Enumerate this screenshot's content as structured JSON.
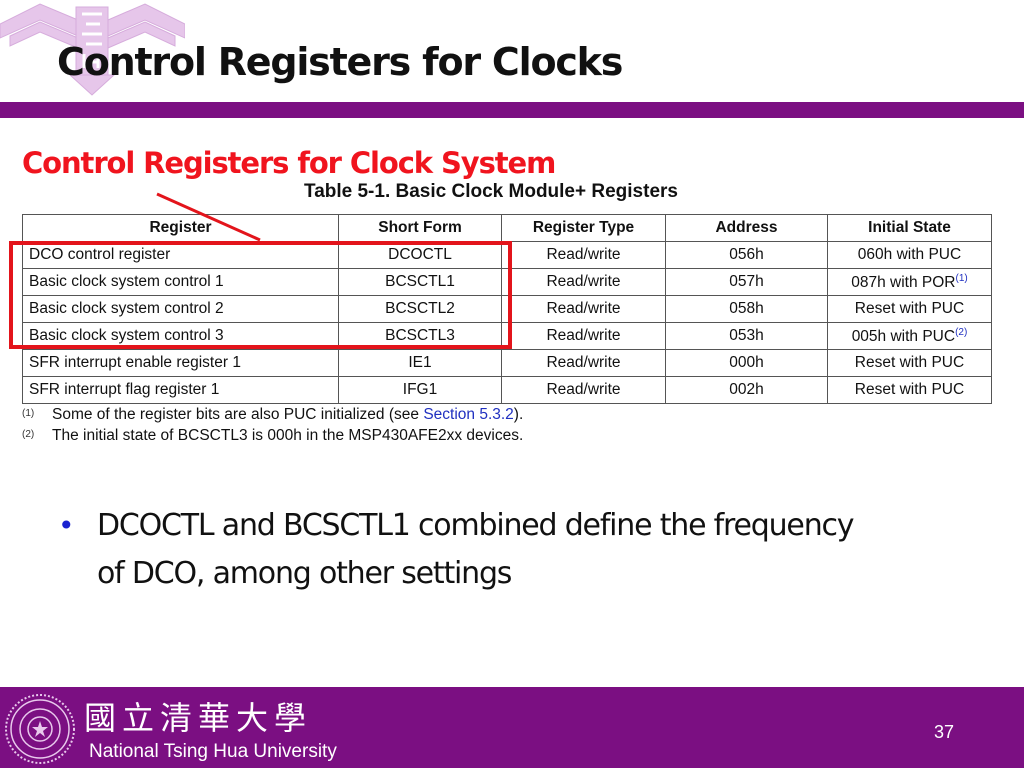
{
  "slide": {
    "title": "Control Registers for Clocks",
    "subtitle": "Control Registers for Clock System",
    "page_number": "37"
  },
  "table": {
    "caption": "Table 5-1. Basic Clock Module+ Registers",
    "headers": [
      "Register",
      "Short Form",
      "Register Type",
      "Address",
      "Initial State"
    ],
    "rows": [
      {
        "register": "DCO control register",
        "short_form": "DCOCTL",
        "type": "Read/write",
        "address": "056h",
        "initial_state": "060h with PUC",
        "note": ""
      },
      {
        "register": "Basic clock system control 1",
        "short_form": "BCSCTL1",
        "type": "Read/write",
        "address": "057h",
        "initial_state": "087h with POR",
        "note": "(1)"
      },
      {
        "register": "Basic clock system control 2",
        "short_form": "BCSCTL2",
        "type": "Read/write",
        "address": "058h",
        "initial_state": "Reset with PUC",
        "note": ""
      },
      {
        "register": "Basic clock system control 3",
        "short_form": "BCSCTL3",
        "type": "Read/write",
        "address": "053h",
        "initial_state": "005h with PUC",
        "note": "(2)"
      },
      {
        "register": "SFR interrupt enable register 1",
        "short_form": "IE1",
        "type": "Read/write",
        "address": "000h",
        "initial_state": "Reset with PUC",
        "note": ""
      },
      {
        "register": "SFR interrupt flag register 1",
        "short_form": "IFG1",
        "type": "Read/write",
        "address": "002h",
        "initial_state": "Reset with PUC",
        "note": ""
      }
    ],
    "highlighted_rows": [
      "DCOCTL",
      "BCSCTL1",
      "BCSCTL2",
      "BCSCTL3"
    ]
  },
  "footnotes": [
    {
      "mark": "(1)",
      "text_before": "Some of the register bits are also PUC initialized (see ",
      "link": "Section 5.3.2",
      "text_after": ")."
    },
    {
      "mark": "(2)",
      "text_before": "The initial state of BCSCTL3 is 000h in the MSP430AFE2xx devices.",
      "link": "",
      "text_after": ""
    }
  ],
  "bullets": [
    {
      "symbol": "•",
      "text": "DCOCTL and BCSCTL1 combined define the frequency of DCO, among other settings"
    }
  ],
  "footer": {
    "university_chinese": "國立清華大學",
    "university_english": "National Tsing Hua University"
  },
  "colors": {
    "brand_purple": "#7b0f82",
    "highlight_red": "#e3141b",
    "link_blue": "#2030c0",
    "bullet_blue": "#1a22d0"
  }
}
